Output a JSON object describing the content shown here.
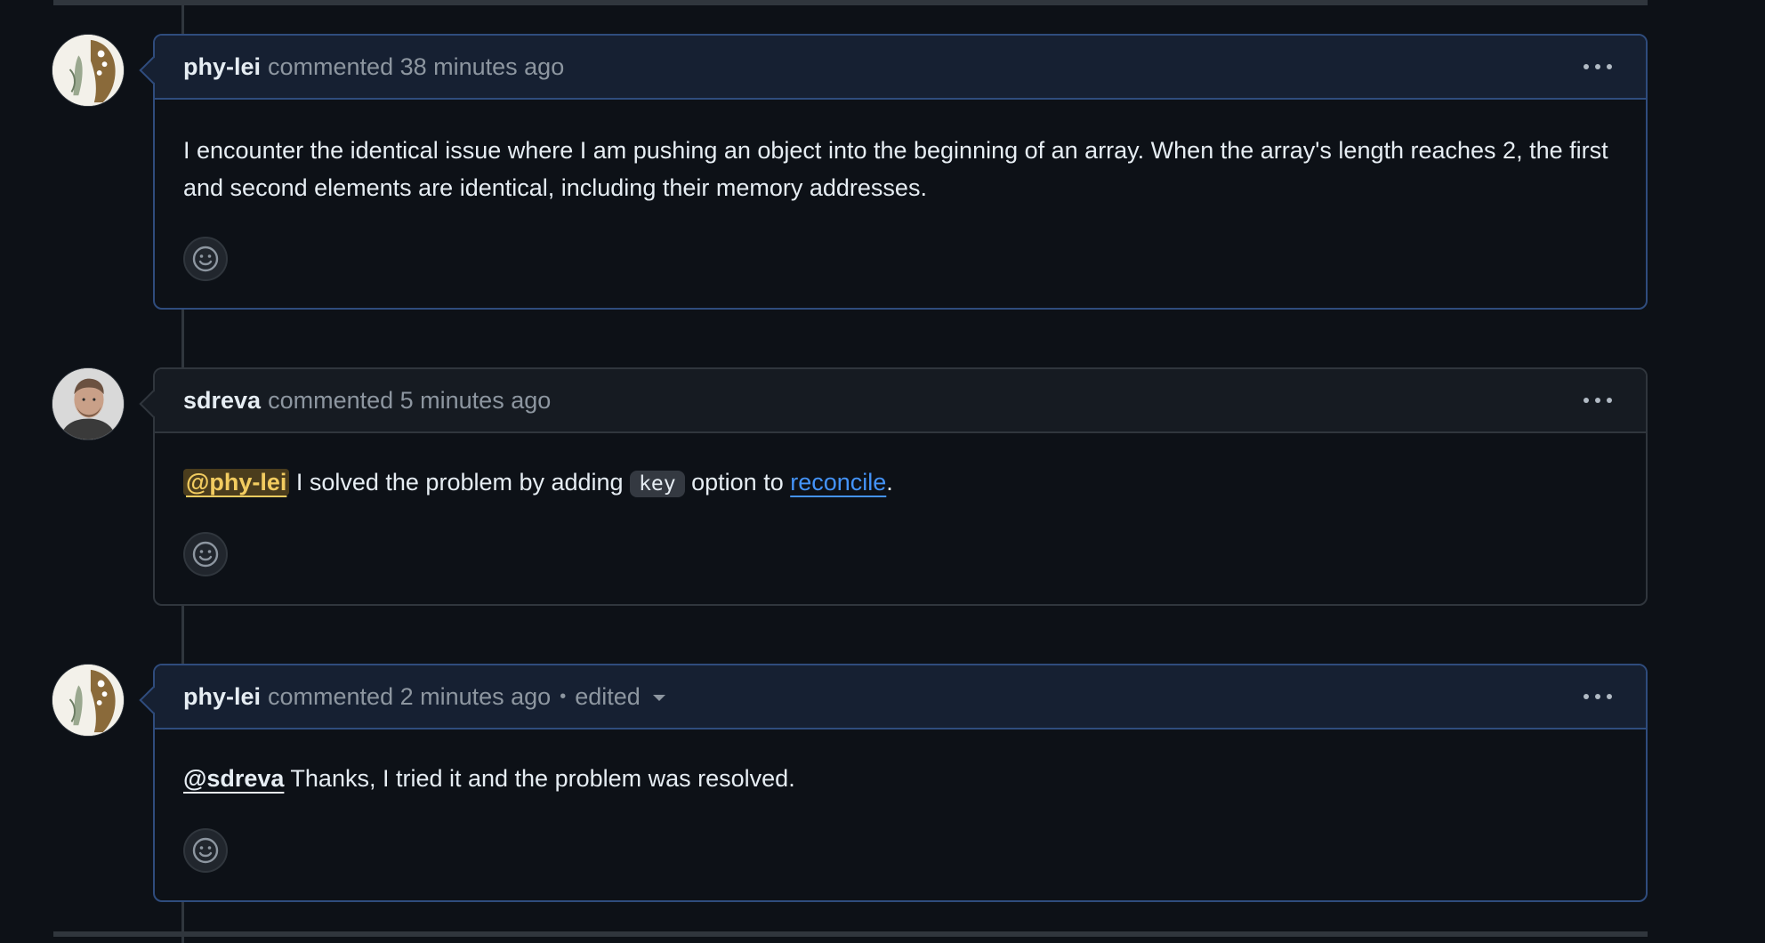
{
  "comments": [
    {
      "author": "phy-lei",
      "meta": "commented 38 minutes ago",
      "edited": "",
      "body": "I encounter the identical issue where I am pushing an object into the beginning of an array. When the array's length reaches 2, the first and second elements are identical, including their memory addresses."
    },
    {
      "author": "sdreva",
      "meta": "commented 5 minutes ago",
      "edited": "",
      "mention": "@phy-lei",
      "text_before_code": " I solved the problem by adding ",
      "code": "key",
      "text_after_code": " option to ",
      "link": "reconcile",
      "text_end": "."
    },
    {
      "author": "phy-lei",
      "meta": "commented 2 minutes ago",
      "separator": "•",
      "edited": "edited",
      "mention": "@sdreva",
      "body": " Thanks, I tried it and the problem was resolved."
    }
  ],
  "icons": {
    "more": "kebab-horizontal-icon",
    "reaction": "smiley-icon",
    "dropdown": "triangle-down-icon"
  },
  "colors": {
    "background": "#0d1117",
    "highlighted_border": "#2f4c7d",
    "link": "#4493f8",
    "mention_highlight": "#f2cc60"
  }
}
